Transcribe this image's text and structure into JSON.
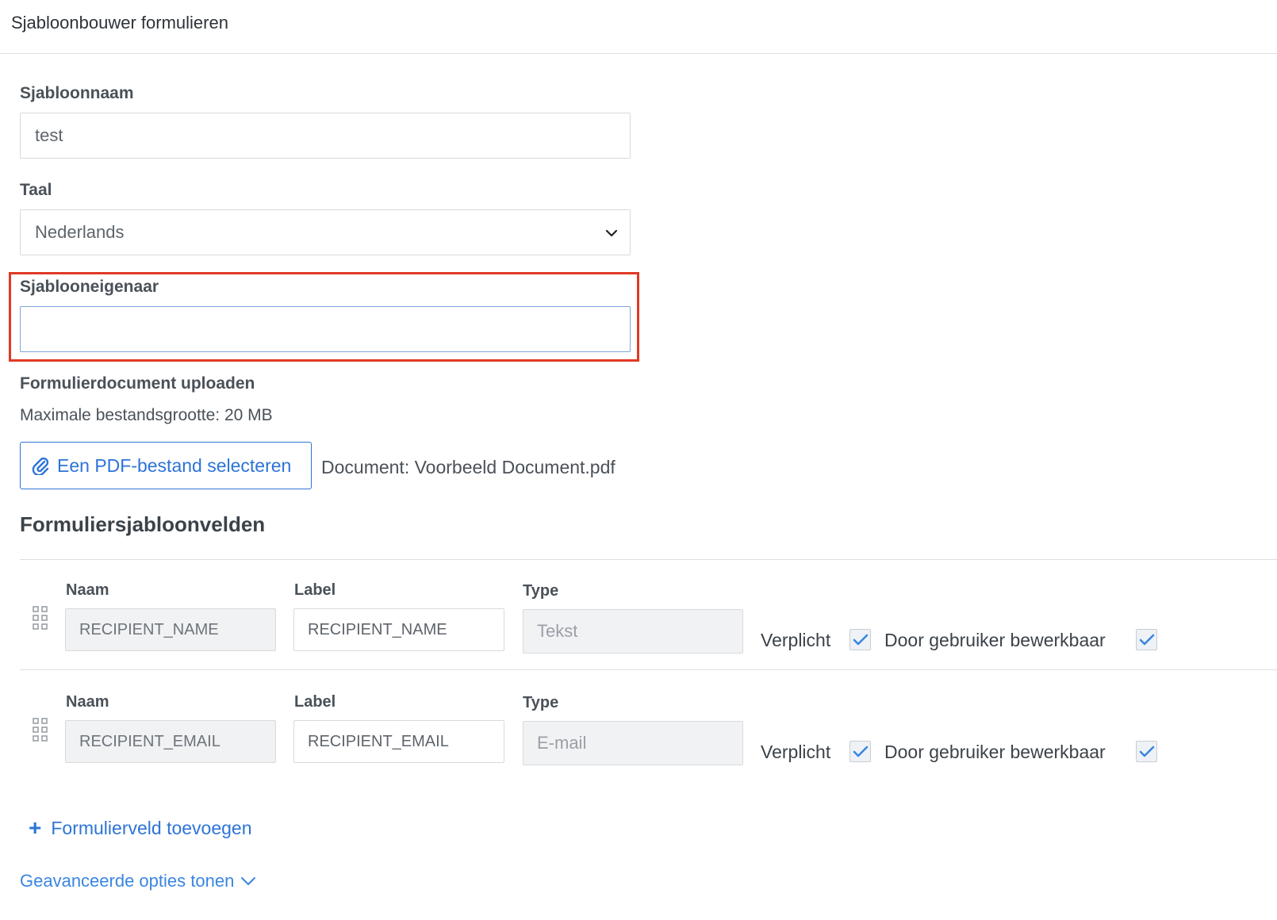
{
  "header": {
    "title": "Sjabloonbouwer formulieren"
  },
  "form": {
    "template_name": {
      "label": "Sjabloonnaam",
      "value": "test"
    },
    "language": {
      "label": "Taal",
      "value": "Nederlands"
    },
    "owner": {
      "label": "Sjablooneigenaar",
      "value": ""
    },
    "upload": {
      "label": "Formulierdocument uploaden",
      "max_size": "Maximale bestandsgrootte: 20 MB",
      "button_label": "Een PDF-bestand selecteren",
      "document": "Document: Voorbeeld Document.pdf"
    }
  },
  "fields_section": {
    "title": "Formuliersjabloonvelden",
    "col_name": "Naam",
    "col_label": "Label",
    "col_type": "Type",
    "required_label": "Verplicht",
    "editable_label": "Door gebruiker bewerkbaar",
    "rows": [
      {
        "name": "RECIPIENT_NAME",
        "label": "RECIPIENT_NAME",
        "type": "Tekst",
        "required": true,
        "editable": true
      },
      {
        "name": "RECIPIENT_EMAIL",
        "label": "RECIPIENT_EMAIL",
        "type": "E-mail",
        "required": true,
        "editable": true
      }
    ],
    "add_field": "Formulierveld toevoegen"
  },
  "advanced": {
    "label": "Geavanceerde opties tonen"
  },
  "colors": {
    "accent": "#2d74d7",
    "highlight": "#e03a24"
  }
}
